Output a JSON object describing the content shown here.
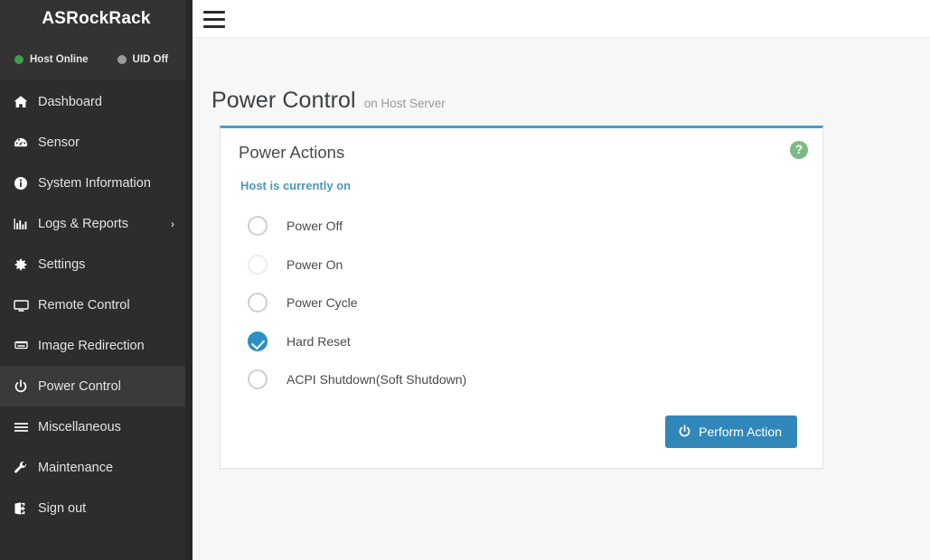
{
  "sidebar": {
    "brand": "ASRockRack",
    "status": [
      {
        "label": "Host Online",
        "color": "#3f9e4d",
        "icon": "status-dot-green"
      },
      {
        "label": "UID Off",
        "color": "#9a9a9a",
        "icon": "status-dot-grey"
      }
    ],
    "items": [
      {
        "label": "Dashboard",
        "icon": "home-icon",
        "name": "dashboard",
        "active": false,
        "expandable": false
      },
      {
        "label": "Sensor",
        "icon": "gauge-icon",
        "name": "sensor",
        "active": false,
        "expandable": false
      },
      {
        "label": "System Information",
        "icon": "info-icon",
        "name": "system-information",
        "active": false,
        "expandable": false
      },
      {
        "label": "Logs & Reports",
        "icon": "bar-chart-icon",
        "name": "logs-and-reports",
        "active": false,
        "expandable": true,
        "chevron": "›"
      },
      {
        "label": "Settings",
        "icon": "gear-icon",
        "name": "settings",
        "active": false,
        "expandable": false
      },
      {
        "label": "Remote Control",
        "icon": "monitor-icon",
        "name": "remote-control",
        "active": false,
        "expandable": false
      },
      {
        "label": "Image Redirection",
        "icon": "disk-icon",
        "name": "image-redirection",
        "active": false,
        "expandable": false
      },
      {
        "label": "Power Control",
        "icon": "power-icon",
        "name": "power-control",
        "active": true,
        "expandable": false
      },
      {
        "label": "Miscellaneous",
        "icon": "list-icon",
        "name": "miscellaneous",
        "active": false,
        "expandable": false
      },
      {
        "label": "Maintenance",
        "icon": "wrench-icon",
        "name": "maintenance",
        "active": false,
        "expandable": false
      },
      {
        "label": "Sign out",
        "icon": "sign-out-icon",
        "name": "sign-out",
        "active": false,
        "expandable": false
      }
    ]
  },
  "topbar": {
    "menu_toggle_icon": "hamburger-icon"
  },
  "page": {
    "title": "Power Control",
    "subtitle": "on Host Server"
  },
  "card": {
    "title": "Power Actions",
    "help_icon": "help-circle-icon",
    "help_glyph": "?",
    "host_status": "Host is currently on",
    "options": [
      {
        "label": "Power Off",
        "name": "power-off",
        "selected": false,
        "disabled": false
      },
      {
        "label": "Power On",
        "name": "power-on",
        "selected": false,
        "disabled": true
      },
      {
        "label": "Power Cycle",
        "name": "power-cycle",
        "selected": false,
        "disabled": false
      },
      {
        "label": "Hard Reset",
        "name": "hard-reset",
        "selected": true,
        "disabled": false
      },
      {
        "label": "ACPI Shutdown(Soft Shutdown)",
        "name": "acpi-shutdown",
        "selected": false,
        "disabled": false
      }
    ],
    "submit_label": "Perform Action",
    "submit_icon": "power-icon"
  },
  "colors": {
    "sidebar_bg": "#2d2d2d",
    "sidebar_header_bg": "#333333",
    "sidebar_active_bg": "#3a3a3a",
    "accent_blue": "#3287ba",
    "card_top_border": "#4b9cc9",
    "status_text_blue": "#4e96b8",
    "radio_selected": "#2a8fc4",
    "help_green": "#7dba83",
    "content_bg": "#f7f7f7"
  }
}
